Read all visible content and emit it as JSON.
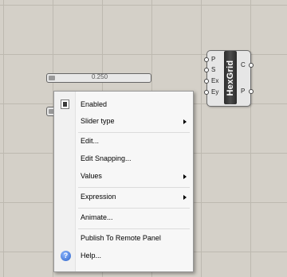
{
  "component": {
    "title": "HexGrid",
    "inputs": [
      "P",
      "S",
      "Ex",
      "Ey"
    ],
    "outputs": [
      "C",
      "P"
    ]
  },
  "slider": {
    "value": "0.250"
  },
  "menu": {
    "enabled": "Enabled",
    "slider_type": "Slider type",
    "edit": "Edit...",
    "edit_snapping": "Edit Snapping...",
    "values": "Values",
    "expression": "Expression",
    "animate": "Animate...",
    "publish": "Publish To Remote Panel",
    "help": "Help...",
    "help_glyph": "?"
  }
}
